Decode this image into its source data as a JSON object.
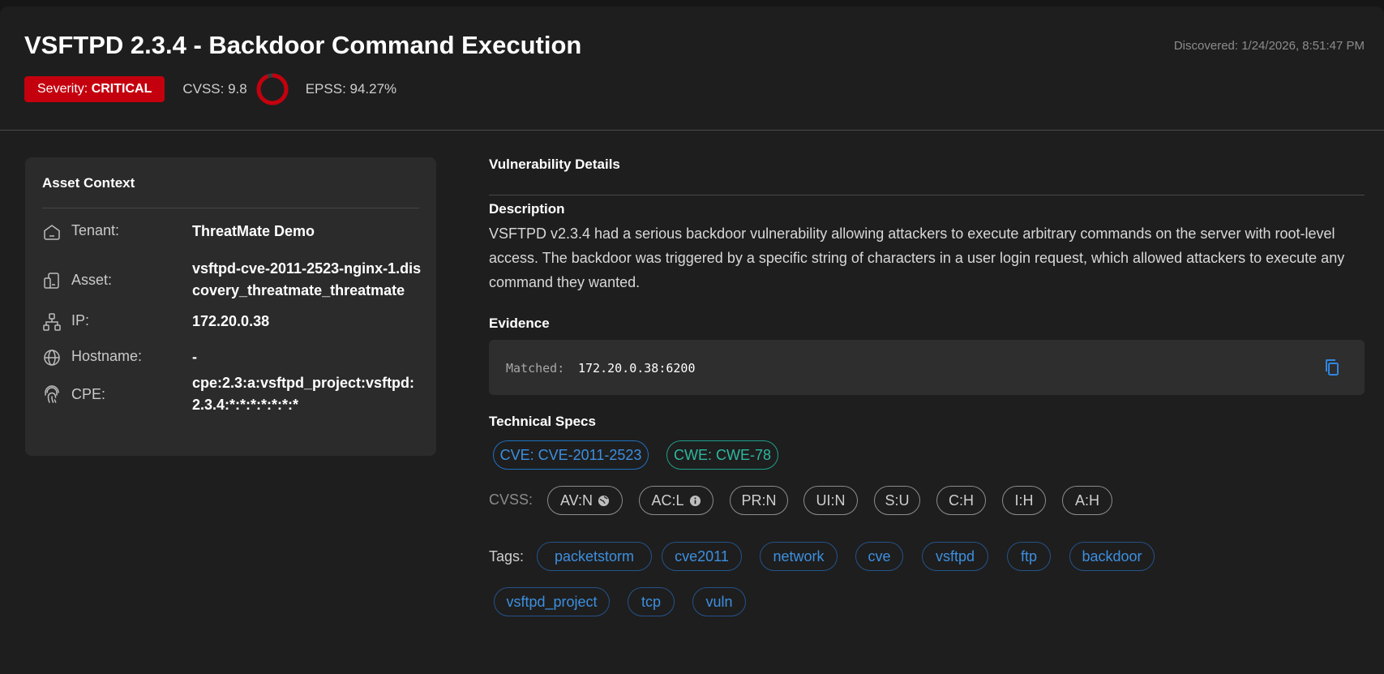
{
  "header": {
    "title": "VSFTPD 2.3.4 - Backdoor Command Execution",
    "discovered": "Discovered: 1/24/2026, 8:51:47 PM",
    "severity_prefix": "Severity: ",
    "severity_value": "CRITICAL",
    "cvss": "CVSS: 9.8",
    "epss": "EPSS: 94.27%",
    "epss_value": 0.9427,
    "severity_color": "#c4000e"
  },
  "asset": {
    "title": "Asset Context",
    "rows": [
      {
        "icon": "home-icon",
        "label": "Tenant:",
        "value": "ThreatMate Demo"
      },
      {
        "icon": "devices-icon",
        "label": "Asset:",
        "value": "vsftpd-cve-2011-2523-nginx-1.discovery_threatmate_threatmate"
      },
      {
        "icon": "network-icon",
        "label": "IP:",
        "value": "172.20.0.38"
      },
      {
        "icon": "globe-icon",
        "label": "Hostname:",
        "value": "-"
      },
      {
        "icon": "fingerprint-icon",
        "label": "CPE:",
        "value": "cpe:2.3:a:vsftpd_project:vsftpd:2.3.4:*:*:*:*:*:*:*"
      }
    ]
  },
  "details": {
    "section_title": "Vulnerability Details",
    "description_title": "Description",
    "description": "VSFTPD v2.3.4 had a serious backdoor vulnerability allowing attackers to execute arbitrary commands on the server with root-level access. The backdoor was triggered by a specific string of characters in a user login request, which allowed attackers to execute any command they wanted.",
    "evidence_title": "Evidence",
    "evidence_label": "Matched:",
    "evidence_value": "172.20.0.38:6200",
    "copy_icon": "copy-icon",
    "tech_title": "Technical Specs",
    "cve": "CVE: CVE-2011-2523",
    "cwe": "CWE: CWE-78",
    "cvss_label": "CVSS:",
    "cvss_vectors": [
      "AV:N",
      "AC:L",
      "PR:N",
      "UI:N",
      "S:U",
      "C:H",
      "I:H",
      "A:H"
    ],
    "tags_label": "Tags:",
    "tags": [
      "packetstorm",
      "cve2011",
      "network",
      "cve",
      "vsftpd",
      "ftp",
      "backdoor",
      "vsftpd_project",
      "tcp",
      "vuln"
    ]
  }
}
